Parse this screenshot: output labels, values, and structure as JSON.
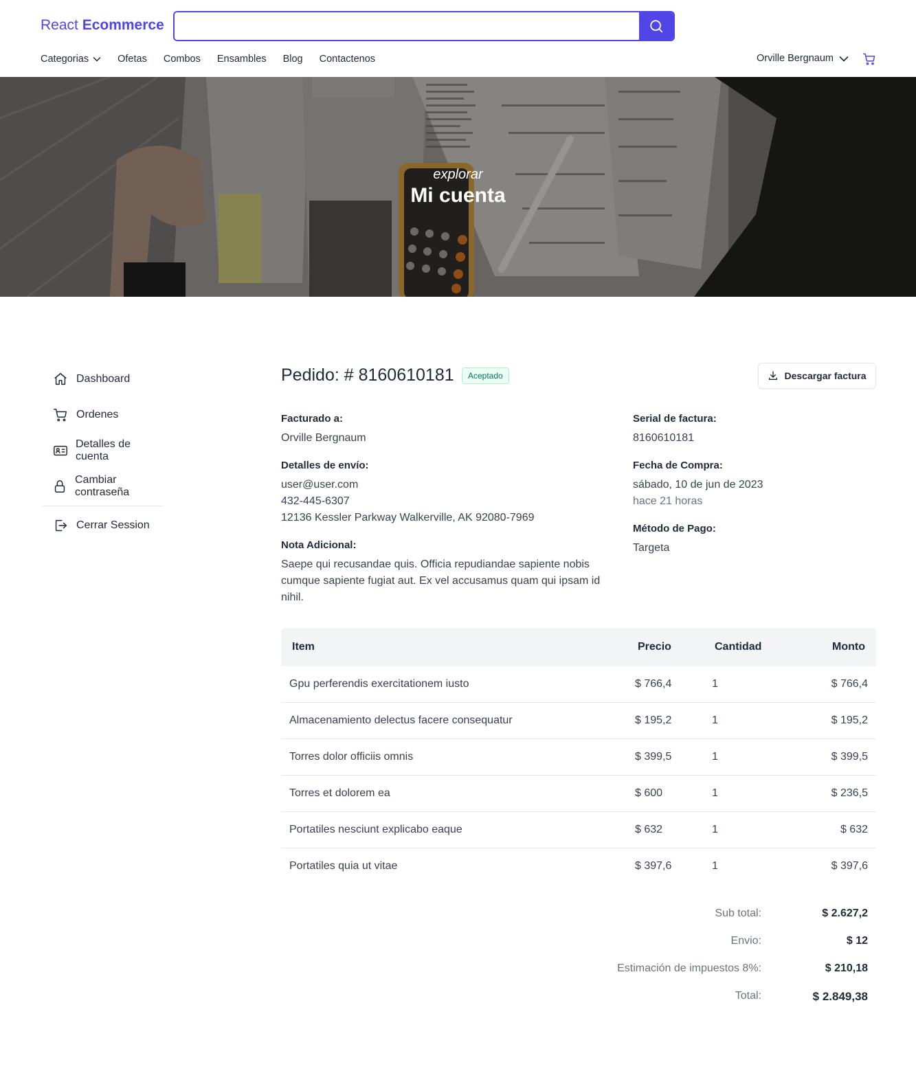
{
  "header": {
    "logo_light": "React",
    "logo_bold": "Ecommerce",
    "search": {
      "value": "",
      "placeholder": ""
    },
    "nav": [
      "Categorias",
      "Ofetas",
      "Combos",
      "Ensambles",
      "Blog",
      "Contactenos"
    ],
    "user_name": "Orville Bergnaum",
    "accent": "#4f46e5"
  },
  "hero": {
    "subtitle": "explorar",
    "title": "Mi cuenta"
  },
  "sidebar": {
    "items": [
      {
        "label": "Dashboard",
        "icon": "home-icon"
      },
      {
        "label": "Ordenes",
        "icon": "cart-icon"
      },
      {
        "label": "Detalles de cuenta",
        "icon": "id-card-icon"
      },
      {
        "label": "Cambiar contraseña",
        "icon": "lock-icon"
      }
    ],
    "logout": {
      "label": "Cerrar Session",
      "icon": "logout-icon"
    }
  },
  "order": {
    "title": "Pedido: # 8160610181",
    "status": "Aceptado",
    "download_label": "Descargar factura",
    "billed_to_label": "Facturado a:",
    "billed_to": "Orville Bergnaum",
    "shipping_label": "Detalles de envío:",
    "email": "user@user.com",
    "phone": "432-445-6307",
    "address": "12136 Kessler Parkway Walkerville, AK 92080-7969",
    "note_label": "Nota Adicional:",
    "note": "Saepe qui recusandae quis. Officia repudiandae sapiente nobis cumque sapiente fugiat aut. Ex vel accusamus quam qui ipsam id nihil.",
    "serial_label": "Serial de factura:",
    "serial": "8160610181",
    "date_label": "Fecha de Compra:",
    "date": "sábado, 10 de jun de 2023",
    "date_relative": "hace 21 horas",
    "payment_label": "Método de Pago:",
    "payment": "Targeta"
  },
  "table": {
    "headers": [
      "Item",
      "Precio",
      "Cantidad",
      "Monto"
    ],
    "rows": [
      {
        "item": "Gpu perferendis exercitationem iusto",
        "precio": "$ 766,4",
        "cantidad": "1",
        "monto": "$ 766,4"
      },
      {
        "item": "Almacenamiento delectus facere consequatur",
        "precio": "$ 195,2",
        "cantidad": "1",
        "monto": "$ 195,2"
      },
      {
        "item": "Torres dolor officiis omnis",
        "precio": "$ 399,5",
        "cantidad": "1",
        "monto": "$ 399,5"
      },
      {
        "item": "Torres et dolorem ea",
        "precio": "$ 600",
        "cantidad": "1",
        "monto": "$ 236,5"
      },
      {
        "item": "Portatiles nesciunt explicabo eaque",
        "precio": "$ 632",
        "cantidad": "1",
        "monto": "$ 632"
      },
      {
        "item": "Portatiles quia ut vitae",
        "precio": "$ 397,6",
        "cantidad": "1",
        "monto": "$ 397,6"
      }
    ]
  },
  "totals": {
    "subtotal_label": "Sub total:",
    "subtotal": "$ 2.627,2",
    "shipping_label": "Envio:",
    "shipping": "$ 12",
    "tax_label": "Estimación de impuestos 8%:",
    "tax": "$ 210,18",
    "total_label": "Total:",
    "total": "$ 2.849,38"
  }
}
